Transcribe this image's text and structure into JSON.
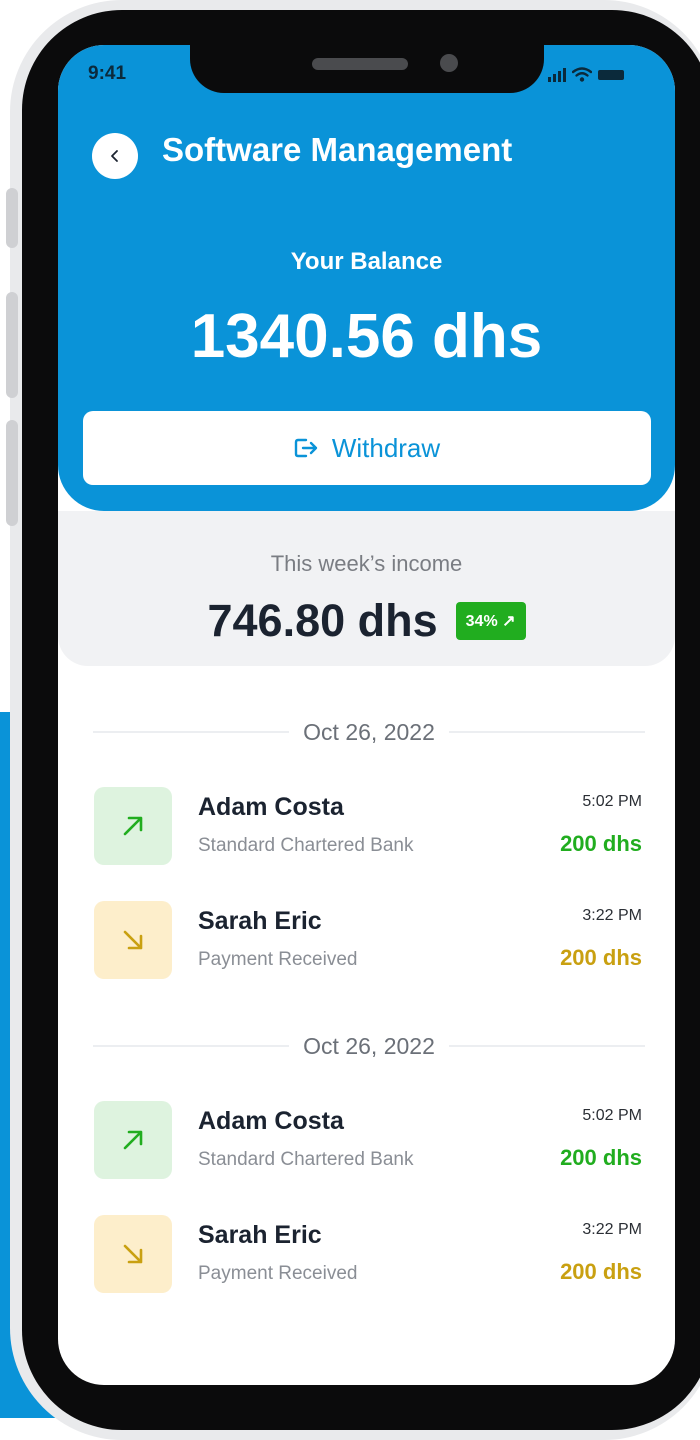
{
  "status_bar": {
    "time": "9:41"
  },
  "header": {
    "title": "Software Management",
    "balance_label": "Your Balance",
    "balance_value": "1340.56 dhs",
    "withdraw_label": "Withdraw"
  },
  "income": {
    "label": "This week’s income",
    "value": "746.80 dhs",
    "change": "34% ↗"
  },
  "groups": [
    {
      "date": "Oct 26, 2022",
      "transactions": [
        {
          "name": "Adam Costa",
          "subtitle": "Standard Chartered Bank",
          "time": "5:02 PM",
          "amount": "200 dhs",
          "direction": "up-right-arrow-icon",
          "color": "#21ad1f"
        },
        {
          "name": "Sarah Eric",
          "subtitle": "Payment Received",
          "time": "3:22 PM",
          "amount": "200 dhs",
          "direction": "down-right-arrow-icon",
          "color": "#c9a011"
        }
      ]
    },
    {
      "date": "Oct 26, 2022",
      "transactions": [
        {
          "name": "Adam Costa",
          "subtitle": "Standard Chartered Bank",
          "time": "5:02 PM",
          "amount": "200 dhs",
          "direction": "up-right-arrow-icon",
          "color": "#21ad1f"
        },
        {
          "name": "Sarah Eric",
          "subtitle": "Payment Received",
          "time": "3:22 PM",
          "amount": "200 dhs",
          "direction": "down-right-arrow-icon",
          "color": "#c9a011"
        }
      ]
    }
  ],
  "colors": {
    "primary": "#0a93d8",
    "income_green": "#21ad1f",
    "expense_gold": "#c9a011"
  }
}
